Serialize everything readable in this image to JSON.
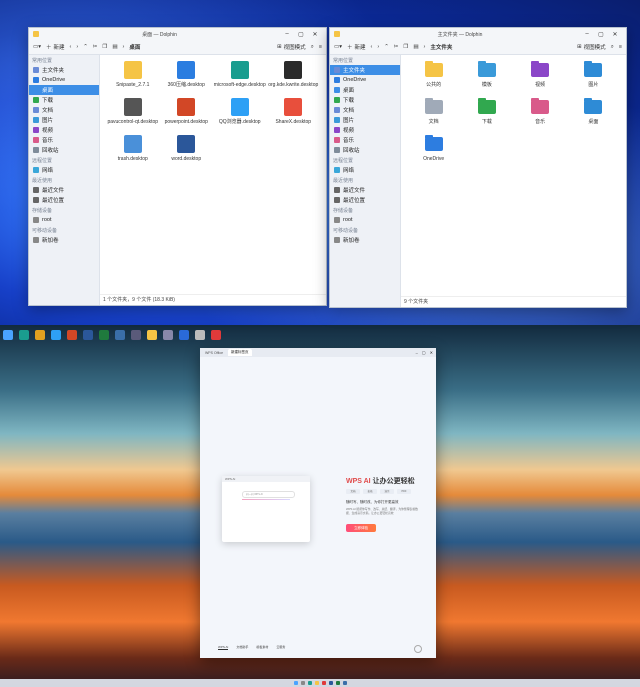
{
  "left_window": {
    "title": "桌面 — Dolphin",
    "toolbar": {
      "new_label": "新建",
      "breadcrumb": "桌面",
      "view_mode": "视图模式"
    },
    "sidebar": {
      "sections": [
        {
          "title": "常用位置",
          "items": [
            {
              "label": "主文件夹",
              "selected": false,
              "icon": "home-icon",
              "color": "#6a8bd6"
            },
            {
              "label": "OneDrive",
              "selected": false,
              "icon": "cloud-icon",
              "color": "#2d7de0"
            },
            {
              "label": "桌面",
              "selected": true,
              "icon": "desktop-icon",
              "color": "#3d8ee6"
            },
            {
              "label": "下载",
              "selected": false,
              "icon": "download-icon",
              "color": "#31a84f"
            },
            {
              "label": "文档",
              "selected": false,
              "icon": "document-icon",
              "color": "#6a8bd6"
            },
            {
              "label": "图片",
              "selected": false,
              "icon": "picture-icon",
              "color": "#3a9ad9"
            },
            {
              "label": "视频",
              "selected": false,
              "icon": "video-icon",
              "color": "#8b46c8"
            },
            {
              "label": "音乐",
              "selected": false,
              "icon": "music-icon",
              "color": "#d95a8a"
            },
            {
              "label": "回收站",
              "selected": false,
              "icon": "trash-icon",
              "color": "#7f8c9a"
            }
          ]
        },
        {
          "title": "远程位置",
          "items": [
            {
              "label": "网络",
              "selected": false,
              "icon": "network-icon",
              "color": "#3aa7d9"
            }
          ]
        },
        {
          "title": "最近使用",
          "items": [
            {
              "label": "最近文件",
              "selected": false,
              "icon": "recent-files-icon",
              "color": "#666"
            },
            {
              "label": "最近位置",
              "selected": false,
              "icon": "recent-places-icon",
              "color": "#666"
            }
          ]
        },
        {
          "title": "存储设备",
          "items": [
            {
              "label": "root",
              "selected": false,
              "icon": "drive-icon",
              "color": "#888"
            }
          ]
        },
        {
          "title": "可移动设备",
          "items": [
            {
              "label": "新加卷",
              "selected": false,
              "icon": "usb-drive-icon",
              "color": "#888"
            }
          ]
        }
      ]
    },
    "files": [
      {
        "label": "Snipaste_2.7.1",
        "icon": "folder-icon",
        "color": "#f5c445"
      },
      {
        "label": "360压缩.desktop",
        "icon": "archive-icon",
        "color": "#2b7de0"
      },
      {
        "label": "microsoft-edge.desktop",
        "icon": "edge-icon",
        "color": "#1a9d8f"
      },
      {
        "label": "org.kde.kwrite.desktop",
        "icon": "kwrite-icon",
        "color": "#2b2b2b"
      },
      {
        "label": "pavucontrol-qt.desktop",
        "icon": "speaker-icon",
        "color": "#555555"
      },
      {
        "label": "powerpoint.desktop",
        "icon": "powerpoint-icon",
        "color": "#d24726"
      },
      {
        "label": "QQ浏览器.desktop",
        "icon": "qq-browser-icon",
        "color": "#2ea0f5"
      },
      {
        "label": "ShareX.desktop",
        "icon": "sharex-icon",
        "color": "#e84f3c"
      },
      {
        "label": "trash.desktop",
        "icon": "recycle-icon",
        "color": "#4a90d9"
      },
      {
        "label": "word.desktop",
        "icon": "word-icon",
        "color": "#2b579a"
      }
    ],
    "status": "1 个文件夹，9 个文件 (18.3 KiB)"
  },
  "right_window": {
    "title": "主文件夹 — Dolphin",
    "toolbar": {
      "new_label": "新建",
      "breadcrumb": "主文件夹",
      "view_mode": "视图模式"
    },
    "sidebar": {
      "sections": [
        {
          "title": "常用位置",
          "items": [
            {
              "label": "主文件夹",
              "selected": true,
              "icon": "home-icon",
              "color": "#6a8bd6"
            },
            {
              "label": "OneDrive",
              "selected": false,
              "icon": "cloud-icon",
              "color": "#2d7de0"
            },
            {
              "label": "桌面",
              "selected": false,
              "icon": "desktop-icon",
              "color": "#3d8ee6"
            },
            {
              "label": "下载",
              "selected": false,
              "icon": "download-icon",
              "color": "#31a84f"
            },
            {
              "label": "文档",
              "selected": false,
              "icon": "document-icon",
              "color": "#6a8bd6"
            },
            {
              "label": "图片",
              "selected": false,
              "icon": "picture-icon",
              "color": "#3a9ad9"
            },
            {
              "label": "视频",
              "selected": false,
              "icon": "video-icon",
              "color": "#8b46c8"
            },
            {
              "label": "音乐",
              "selected": false,
              "icon": "music-icon",
              "color": "#d95a8a"
            },
            {
              "label": "回收站",
              "selected": false,
              "icon": "trash-icon",
              "color": "#7f8c9a"
            }
          ]
        },
        {
          "title": "远程位置",
          "items": [
            {
              "label": "网络",
              "selected": false,
              "icon": "network-icon",
              "color": "#3aa7d9"
            }
          ]
        },
        {
          "title": "最近使用",
          "items": [
            {
              "label": "最近文件",
              "selected": false,
              "icon": "recent-files-icon",
              "color": "#666"
            },
            {
              "label": "最近位置",
              "selected": false,
              "icon": "recent-places-icon",
              "color": "#666"
            }
          ]
        },
        {
          "title": "存储设备",
          "items": [
            {
              "label": "root",
              "selected": false,
              "icon": "drive-icon",
              "color": "#888"
            }
          ]
        },
        {
          "title": "可移动设备",
          "items": [
            {
              "label": "新加卷",
              "selected": false,
              "icon": "usb-drive-icon",
              "color": "#888"
            }
          ]
        }
      ]
    },
    "files": [
      {
        "label": "公共的",
        "icon": "public-folder-icon",
        "color": "#f5c445"
      },
      {
        "label": "模板",
        "icon": "templates-folder-icon",
        "color": "#3a9ad9"
      },
      {
        "label": "视频",
        "icon": "videos-folder-icon",
        "color": "#8b46c8"
      },
      {
        "label": "图片",
        "icon": "pictures-folder-icon",
        "color": "#2e8bd6"
      },
      {
        "label": "文档",
        "icon": "documents-folder-icon",
        "color": "#a0aab8"
      },
      {
        "label": "下载",
        "icon": "downloads-folder-icon",
        "color": "#31a84f"
      },
      {
        "label": "音乐",
        "icon": "music-folder-icon",
        "color": "#d95a8a"
      },
      {
        "label": "桌面",
        "icon": "desktop-folder-icon",
        "color": "#2e8bd6"
      },
      {
        "label": "OneDrive",
        "icon": "onedrive-icon",
        "color": "#2d7de0"
      }
    ],
    "status": "9 个文件夹"
  },
  "taskbar_top": {
    "items": [
      {
        "label": "",
        "icon": "start-icon",
        "color": "#4aa3ff"
      },
      {
        "label": "",
        "icon": "edge-icon",
        "color": "#1a9d8f"
      },
      {
        "label": "",
        "icon": "chrome-icon",
        "color": "#e0a020"
      },
      {
        "label": "",
        "icon": "qq-browser-icon",
        "color": "#2ea0f5"
      },
      {
        "label": "",
        "icon": "powerpoint-icon",
        "color": "#d24726"
      },
      {
        "label": "",
        "icon": "word-icon",
        "color": "#2b579a"
      },
      {
        "label": "",
        "icon": "excel-icon",
        "color": "#1f7a3d"
      },
      {
        "label": "",
        "icon": "app-icon",
        "color": "#3a6ea8"
      },
      {
        "label": "",
        "icon": "app-icon-2",
        "color": "#5a5a7a"
      },
      {
        "label": "",
        "icon": "folder-icon",
        "color": "#f5c445"
      },
      {
        "label": "",
        "icon": "app-icon-3",
        "color": "#8888aa"
      },
      {
        "label": "",
        "icon": "shield-icon",
        "color": "#2a6ad9"
      },
      {
        "label": "",
        "icon": "app-icon-4",
        "color": "#bbbbbb"
      },
      {
        "label": "",
        "icon": "wps-icon",
        "color": "#e03a3a"
      }
    ]
  },
  "wps": {
    "tabs": [
      {
        "label": "WPS Office",
        "active": false
      },
      {
        "label": "新建标签页",
        "active": true
      }
    ],
    "card_title": "WPS AI",
    "card_search": "问一问 WPS AI",
    "headline_ai": "WPS AI",
    "headline_rest": "让办公更轻松",
    "chips": [
      "文档",
      "表格",
      "演示",
      "PDF"
    ],
    "subtitle": "随时写、随时改、为你打开更高效",
    "description": "WPS AI 能帮你写作、改写、总结、翻译，为你整理表格数据、生成演示文稿，让办公更轻松高效",
    "button": "立即体验",
    "bottom_tabs": [
      {
        "label": "WPS AI",
        "active": true
      },
      {
        "label": "文档助手",
        "active": false
      },
      {
        "label": "模板素材",
        "active": false
      },
      {
        "label": "云服务",
        "active": false
      }
    ]
  },
  "bottom_taskbar": {
    "icons": [
      {
        "icon": "start-icon",
        "color": "#4aa3ff"
      },
      {
        "icon": "search-icon",
        "color": "#888888"
      },
      {
        "icon": "edge-icon",
        "color": "#1a9d8f"
      },
      {
        "icon": "folder-icon",
        "color": "#f5c445"
      },
      {
        "icon": "wps-icon",
        "color": "#e03a3a"
      },
      {
        "icon": "word-icon",
        "color": "#2b579a"
      },
      {
        "icon": "excel-icon",
        "color": "#1f7a3d"
      },
      {
        "icon": "app-icon",
        "color": "#3a6ea8"
      }
    ]
  }
}
